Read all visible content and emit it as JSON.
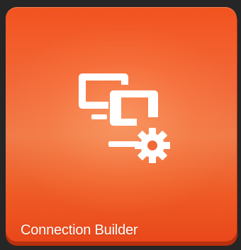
{
  "tile": {
    "label": "Connection Builder",
    "icon": "monitors-gear-icon",
    "accent_color": "#f05a25",
    "icon_color": "#ffffff"
  }
}
